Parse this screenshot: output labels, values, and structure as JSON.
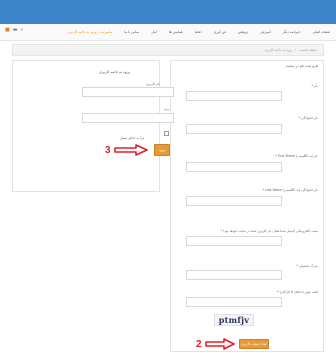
{
  "navbar": {
    "items": [
      {
        "label": "صفحه اصلی"
      },
      {
        "label": "خبرنامه دیگر"
      },
      {
        "label": "آموزش"
      },
      {
        "label": "پژوهش"
      },
      {
        "label": "فن آوری"
      },
      {
        "label": "اعضا"
      },
      {
        "label": "همایش ها"
      },
      {
        "label": "آمار"
      },
      {
        "label": "تماس با ما"
      },
      {
        "label": "ماموریت : ورود به ناحیه کاربری",
        "active": true
      }
    ],
    "icons": [
      "cart-icon",
      "search-icon"
    ]
  },
  "breadcrumb": {
    "items": [
      "صفحه نخست",
      "ورود به ناحیه کاربری"
    ]
  },
  "register": {
    "title": "فرم ثبت نام در سایت",
    "fields": [
      {
        "label": "نام *"
      },
      {
        "label": "نام خانوادگی *"
      },
      {
        "label": "نام (به انگلیسی) First Name *"
      },
      {
        "label": "نام خانوادگی (به انگلیسی) Last Name *"
      },
      {
        "label": "پست الکترونیکی (ایمیل شما همان نام کاربری شما در سایت خواهد بود) *"
      },
      {
        "label": "مدرک تحصیلی *"
      },
      {
        "label": "کلمه عبور (حداقل 6 کاراکتر) *"
      }
    ],
    "captcha_text": "ptmfjv",
    "submit_label": "ایجاد حساب کاربری"
  },
  "login": {
    "title": "ورود به ناحیه کاربری",
    "username_label": "نام کاربری",
    "password_label": "رمز",
    "remember_label": "مرا به خاطر بسپار",
    "submit_label": "ورود"
  },
  "annotations": {
    "step2": "2",
    "step3": "3"
  },
  "colors": {
    "topbar": "#3d84c9",
    "accent": "#e69a3a",
    "annotation": "#e0202a"
  }
}
